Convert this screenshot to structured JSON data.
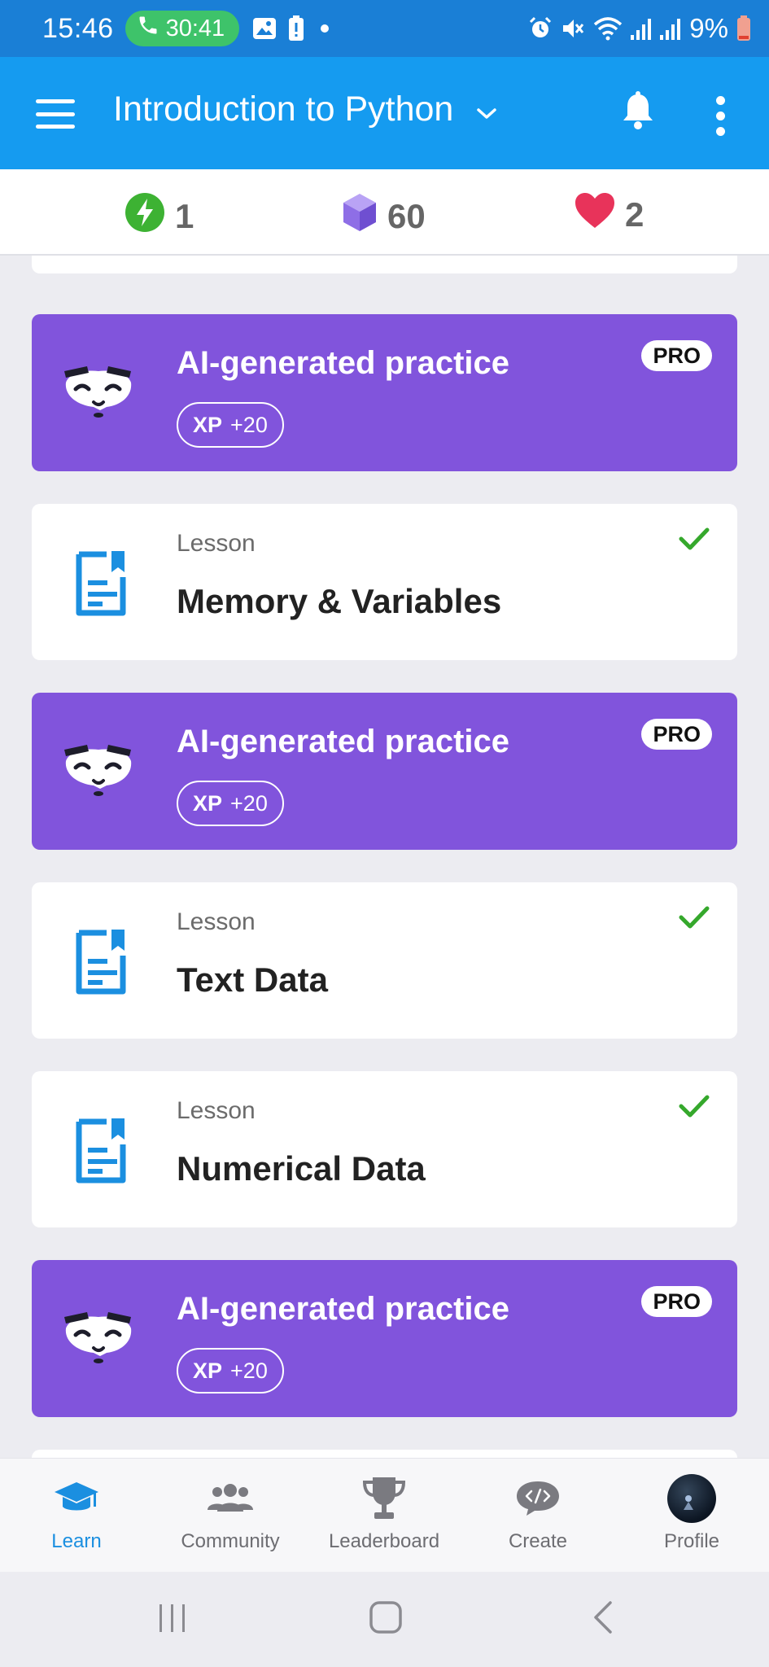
{
  "status_bar": {
    "time": "15:46",
    "call_timer": "30:41",
    "battery": "9%",
    "left_icons": [
      "phone-icon",
      "image-icon",
      "battery-alert-icon",
      "dot-icon"
    ],
    "right_icons": [
      "alarm-icon",
      "mute-icon",
      "wifi-icon",
      "signal-icon",
      "signal-icon",
      "battery-icon"
    ]
  },
  "app_bar": {
    "title": "Introduction to Python",
    "icons": [
      "menu-icon",
      "chevron-down-icon",
      "bell-icon",
      "more-vert-icon"
    ]
  },
  "stats": {
    "energy": "1",
    "gems": "60",
    "hearts": "2"
  },
  "cards": [
    {
      "type": "ai",
      "title": "AI-generated practice",
      "xp_label": "XP",
      "xp_value": "+20",
      "badge": "PRO"
    },
    {
      "type": "lesson",
      "subtitle": "Lesson",
      "title": "Memory & Variables",
      "completed": true
    },
    {
      "type": "ai",
      "title": "AI-generated practice",
      "xp_label": "XP",
      "xp_value": "+20",
      "badge": "PRO"
    },
    {
      "type": "lesson",
      "subtitle": "Lesson",
      "title": "Text Data",
      "completed": true
    },
    {
      "type": "lesson",
      "subtitle": "Lesson",
      "title": "Numerical Data",
      "completed": true
    },
    {
      "type": "ai",
      "title": "AI-generated practice",
      "xp_label": "XP",
      "xp_value": "+20",
      "badge": "PRO"
    }
  ],
  "bottom_nav": [
    {
      "label": "Learn",
      "icon": "graduation-cap-icon",
      "active": true
    },
    {
      "label": "Community",
      "icon": "people-icon",
      "active": false
    },
    {
      "label": "Leaderboard",
      "icon": "trophy-icon",
      "active": false
    },
    {
      "label": "Create",
      "icon": "code-bubble-icon",
      "active": false
    },
    {
      "label": "Profile",
      "icon": "avatar",
      "active": false
    }
  ],
  "colors": {
    "status_bar": "#1a7fd6",
    "app_bar": "#159bf0",
    "ai_card": "#8154dc",
    "accent_blue": "#1b8fe0",
    "check_green": "#35a82c",
    "heart": "#e8335a",
    "gem": "#8e6ee6",
    "energy": "#3db233"
  }
}
